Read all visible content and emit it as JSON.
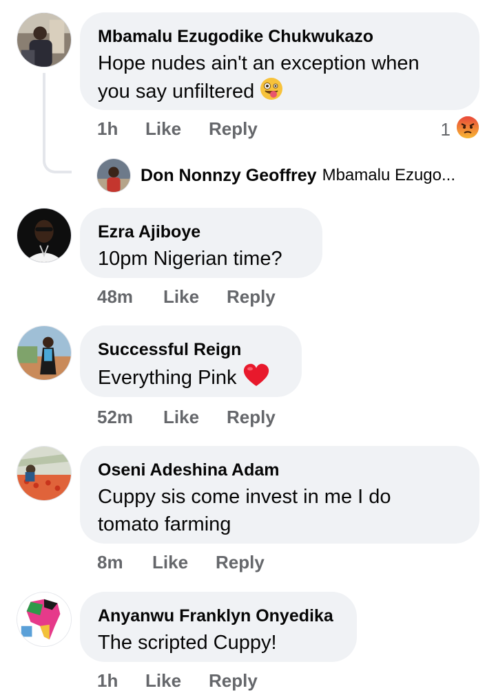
{
  "comments": [
    {
      "author": "Mbamalu Ezugodike Chukwukazo",
      "text_line1": "Hope nudes ain't an exception when",
      "text_line2": "you say unfiltered",
      "emoji": "grinning-tongue-emoji",
      "time": "1h",
      "like": "Like",
      "reply": "Reply",
      "reaction_count": "1",
      "reaction": "angry-emoji",
      "reply_preview": {
        "author": "Don Nonnzy Geoffrey",
        "snippet": "Mbamalu Ezugo..."
      }
    },
    {
      "author": "Ezra Ajiboye",
      "text": "10pm Nigerian time?",
      "time": "48m",
      "like": "Like",
      "reply": "Reply"
    },
    {
      "author": "Successful Reign",
      "text": "Everything Pink",
      "emoji": "red-heart-emoji",
      "time": "52m",
      "like": "Like",
      "reply": "Reply"
    },
    {
      "author": "Oseni Adeshina Adam",
      "text_line1": "Cuppy sis come invest in me I do",
      "text_line2": "tomato farming",
      "time": "8m",
      "like": "Like",
      "reply": "Reply"
    },
    {
      "author": "Anyanwu Franklyn Onyedika",
      "text": "The scripted Cuppy!",
      "time": "1h",
      "like": "Like",
      "reply": "Reply"
    }
  ],
  "colors": {
    "bubble": "#f0f2f5",
    "meta": "#65676b",
    "text": "#050505"
  }
}
